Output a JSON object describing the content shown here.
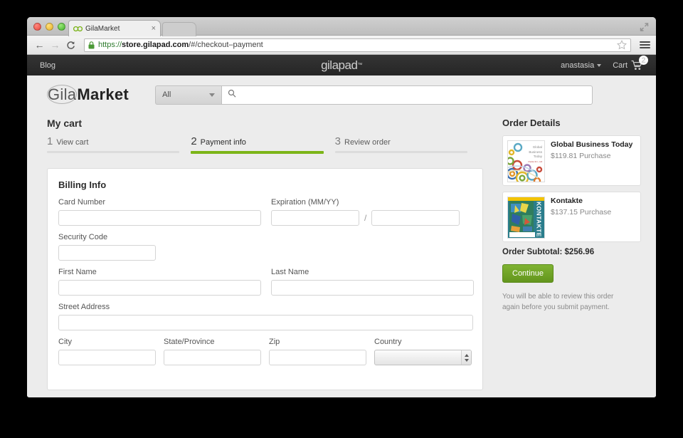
{
  "browser": {
    "tab_title": "GilaMarket",
    "tab_close": "×",
    "url_scheme": "https://",
    "url_host": "store.gilapad.com",
    "url_rest": "/#/checkout–payment",
    "back_glyph": "←",
    "forward_glyph": "→",
    "reload_glyph": "C"
  },
  "topnav": {
    "blog": "Blog",
    "logo_gila": "gila",
    "logo_pad": "pad",
    "logo_tm": "™",
    "account": "anastasia",
    "cart_label": "Cart",
    "cart_count": "2"
  },
  "header": {
    "logo_light": "Gila",
    "logo_bold": "Market",
    "search_category": "All",
    "search_value": "",
    "search_placeholder": ""
  },
  "checkout": {
    "title": "My cart",
    "steps": [
      {
        "num": "1",
        "label": "View cart",
        "active": false
      },
      {
        "num": "2",
        "label": "Payment info",
        "active": true
      },
      {
        "num": "3",
        "label": "Review order",
        "active": false
      }
    ]
  },
  "billing": {
    "heading": "Billing Info",
    "card_number_label": "Card Number",
    "card_number_value": "",
    "expiration_label": "Expiration (MM/YY)",
    "expiration_month_value": "",
    "expiration_year_value": "",
    "expiration_separator": "/",
    "security_code_label": "Security Code",
    "security_code_value": "",
    "first_name_label": "First Name",
    "first_name_value": "",
    "last_name_label": "Last Name",
    "last_name_value": "",
    "street_label": "Street Address",
    "street_value": "",
    "city_label": "City",
    "city_value": "",
    "state_label": "State/Province",
    "state_value": "",
    "zip_label": "Zip",
    "zip_value": "",
    "country_label": "Country",
    "country_value": ""
  },
  "order": {
    "heading": "Order Details",
    "items": [
      {
        "name": "Global Business Today",
        "price": "$119.81 Purchase",
        "cover_title_line1": "Global",
        "cover_title_line2": "Business",
        "cover_title_line3": "Today",
        "cover_byline": "Charles W. L. Hill"
      },
      {
        "name": "Kontakte",
        "price": "$137.15 Purchase",
        "cover_spine": "KONTAKTE"
      }
    ],
    "subtotal": "Order Subtotal: $256.96",
    "continue_label": "Continue",
    "note": "You will be able to review this order again before you submit payment."
  },
  "colors": {
    "accent_green": "#7cb518",
    "button_green": "#63951d",
    "navbar_dark": "#2b2b2b",
    "page_bg": "#ececec"
  }
}
